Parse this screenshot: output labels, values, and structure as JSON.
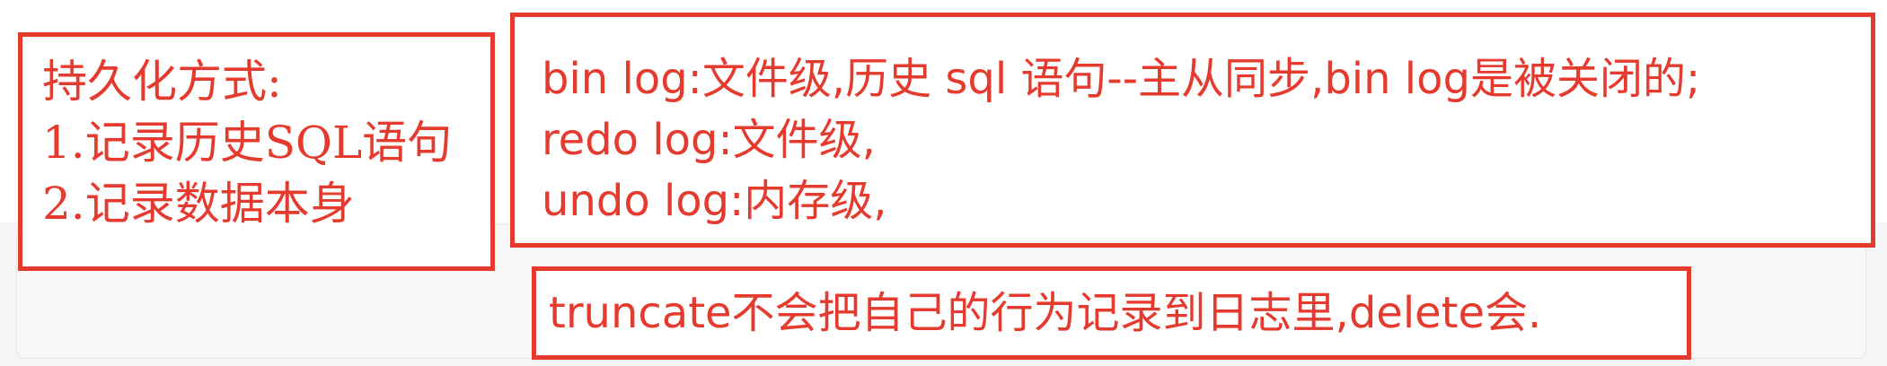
{
  "persistence_note": {
    "title": "持久化方式:",
    "item_1": "1.记录历史SQL语句",
    "item_2": "2.记录数据本身"
  },
  "log_note": {
    "line_1": "bin log:文件级,历史 sql 语句--主从同步,bin log是被关闭的;",
    "line_2": "redo log:文件级,",
    "line_3": "undo log:内存级,"
  },
  "truncate_note": {
    "text": "truncate不会把自己的行为记录到日志里,delete会."
  },
  "colors": {
    "annotation_red": "#e53a2e",
    "panel_background": "#f5f5f6"
  }
}
